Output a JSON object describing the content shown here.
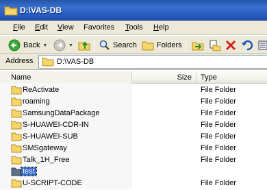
{
  "window": {
    "title": "D:\\VAS-DB"
  },
  "menu": [
    {
      "ul": "F",
      "rest": "ile"
    },
    {
      "ul": "E",
      "rest": "dit"
    },
    {
      "ul": "V",
      "rest": "iew"
    },
    {
      "ul": "",
      "rest": "Favorites"
    },
    {
      "ul": "T",
      "rest": "ools"
    },
    {
      "ul": "H",
      "rest": "elp"
    }
  ],
  "toolbar": {
    "back": "Back",
    "search": "Search",
    "folders": "Folders"
  },
  "address": {
    "label": "Address",
    "value": "D:\\VAS-DB"
  },
  "columns": {
    "name": "Name",
    "size": "Size",
    "type": "Type"
  },
  "rows": [
    {
      "name": "ReActivate",
      "type": "File Folder"
    },
    {
      "name": "roaming",
      "type": "File Folder"
    },
    {
      "name": "SamsungDataPackage",
      "type": "File Folder"
    },
    {
      "name": "S-HUAWEI-CDR-IN",
      "type": "File Folder"
    },
    {
      "name": "S-HUAWEI-SUB",
      "type": "File Folder"
    },
    {
      "name": "SMSgateway",
      "type": "File Folder"
    },
    {
      "name": "Talk_1H_Free",
      "type": "File Folder"
    },
    {
      "name": "test",
      "type": ""
    },
    {
      "name": "U-SCRIPT-CODE",
      "type": "File Folder"
    }
  ],
  "selected_row": "test",
  "colors": {
    "titlebar": "#2a5fc2",
    "chrome": "#ece9d8",
    "selection": "#316ac5",
    "folder": "#f5d66b"
  }
}
